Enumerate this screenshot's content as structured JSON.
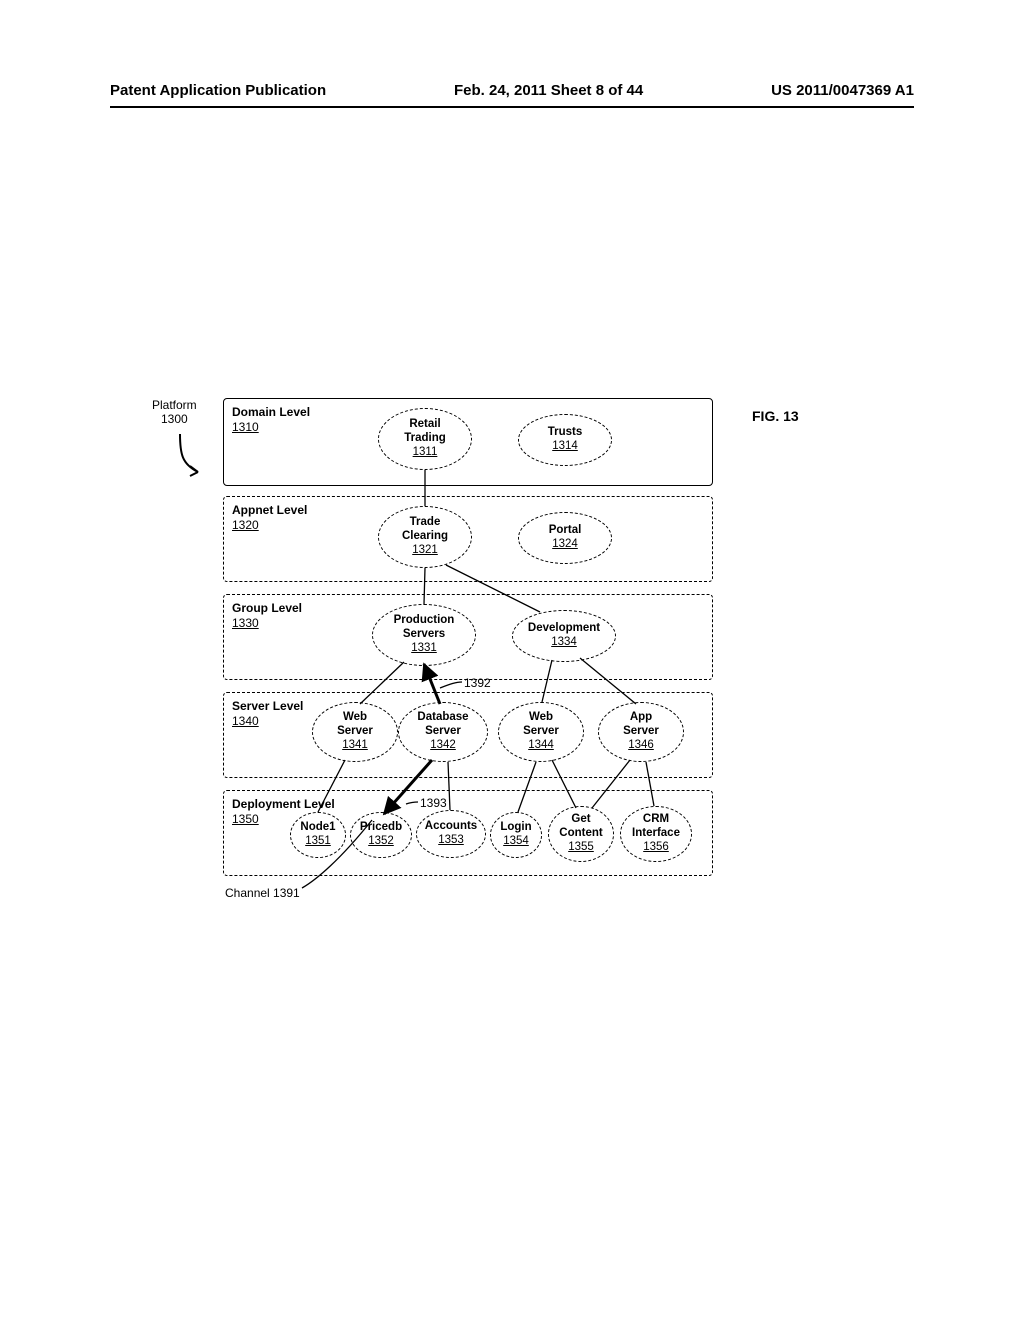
{
  "header": {
    "left": "Patent Application Publication",
    "center": "Feb. 24, 2011  Sheet 8 of 44",
    "right": "US 2011/0047369 A1"
  },
  "figure_label": "FIG. 13",
  "platform": {
    "label": "Platform",
    "num": "1300"
  },
  "channel_label": "Channel 1391",
  "callout_1392": "1392",
  "callout_1393": "1393",
  "levels": {
    "domain": {
      "title": "Domain Level",
      "num": "1310"
    },
    "appnet": {
      "title": "Appnet Level",
      "num": "1320"
    },
    "group": {
      "title": "Group Level",
      "num": "1330"
    },
    "server": {
      "title": "Server Level",
      "num": "1340"
    },
    "deployment": {
      "title": "Deployment Level",
      "num": "1350"
    }
  },
  "nodes": {
    "retail_trading": {
      "lines": [
        "Retail",
        "Trading"
      ],
      "num": "1311"
    },
    "trusts": {
      "lines": [
        "Trusts"
      ],
      "num": "1314"
    },
    "trade_clearing": {
      "lines": [
        "Trade",
        "Clearing"
      ],
      "num": "1321"
    },
    "portal": {
      "lines": [
        "Portal"
      ],
      "num": "1324"
    },
    "production_servers": {
      "lines": [
        "Production",
        "Servers"
      ],
      "num": "1331"
    },
    "development": {
      "lines": [
        "Development"
      ],
      "num": "1334"
    },
    "web_server1": {
      "lines": [
        "Web",
        "Server"
      ],
      "num": "1341"
    },
    "db_server": {
      "lines": [
        "Database",
        "Server"
      ],
      "num": "1342"
    },
    "web_server2": {
      "lines": [
        "Web",
        "Server"
      ],
      "num": "1344"
    },
    "app_server": {
      "lines": [
        "App",
        "Server"
      ],
      "num": "1346"
    },
    "node1": {
      "lines": [
        "Node1"
      ],
      "num": "1351"
    },
    "pricedb": {
      "lines": [
        "Pricedb"
      ],
      "num": "1352"
    },
    "accounts": {
      "lines": [
        "Accounts"
      ],
      "num": "1353"
    },
    "login": {
      "lines": [
        "Login"
      ],
      "num": "1354"
    },
    "get_content": {
      "lines": [
        "Get",
        "Content"
      ],
      "num": "1355"
    },
    "crm_interface": {
      "lines": [
        "CRM",
        "Interface"
      ],
      "num": "1356"
    }
  },
  "chart_data": {
    "type": "diagram",
    "title": "FIG. 13 — Platform 1300 hierarchy",
    "levels": [
      {
        "id": "1310",
        "name": "Domain Level",
        "nodes": [
          "1311",
          "1314"
        ]
      },
      {
        "id": "1320",
        "name": "Appnet Level",
        "nodes": [
          "1321",
          "1324"
        ]
      },
      {
        "id": "1330",
        "name": "Group Level",
        "nodes": [
          "1331",
          "1334"
        ]
      },
      {
        "id": "1340",
        "name": "Server Level",
        "nodes": [
          "1341",
          "1342",
          "1344",
          "1346"
        ]
      },
      {
        "id": "1350",
        "name": "Deployment Level",
        "nodes": [
          "1351",
          "1352",
          "1353",
          "1354",
          "1355",
          "1356"
        ]
      }
    ],
    "nodes": {
      "1311": "Retail Trading",
      "1314": "Trusts",
      "1321": "Trade Clearing",
      "1324": "Portal",
      "1331": "Production Servers",
      "1334": "Development",
      "1341": "Web Server",
      "1342": "Database Server",
      "1344": "Web Server",
      "1346": "App Server",
      "1351": "Node1",
      "1352": "Pricedb",
      "1353": "Accounts",
      "1354": "Login",
      "1355": "Get Content",
      "1356": "CRM Interface"
    },
    "edges": [
      [
        "1311",
        "1321"
      ],
      [
        "1321",
        "1331"
      ],
      [
        "1321",
        "1334"
      ],
      [
        "1331",
        "1341"
      ],
      [
        "1331",
        "1342"
      ],
      [
        "1334",
        "1344"
      ],
      [
        "1334",
        "1346"
      ],
      [
        "1341",
        "1351"
      ],
      [
        "1342",
        "1352"
      ],
      [
        "1342",
        "1353"
      ],
      [
        "1344",
        "1354"
      ],
      [
        "1344",
        "1355"
      ],
      [
        "1346",
        "1355"
      ],
      [
        "1346",
        "1356"
      ]
    ],
    "channel": {
      "id": "1391",
      "path": [
        "1331",
        "1342",
        "1352"
      ],
      "bold": true,
      "arrows": "both"
    },
    "callouts": {
      "1392": "segment 1331-1342",
      "1393": "segment 1342-1352"
    }
  }
}
